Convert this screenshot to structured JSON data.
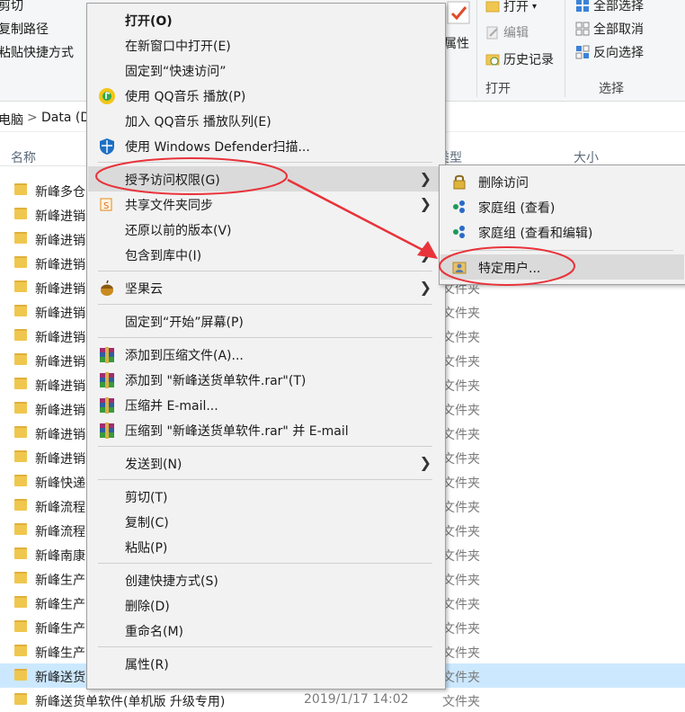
{
  "ribbon": {
    "left_items": [
      "剪切",
      "复制路径",
      "粘贴快捷方式"
    ],
    "properties_label": "属性",
    "open_items": [
      "打开",
      "编辑",
      "历史记录"
    ],
    "open_group": "打开",
    "select_items": [
      "全部选择",
      "全部取消",
      "反向选择"
    ],
    "select_group": "选择"
  },
  "address": {
    "part1": "电脑",
    "sep": ">",
    "part2": "Data (D"
  },
  "columns": {
    "name": "名称",
    "type": "类型",
    "size": "大小"
  },
  "file_rows": [
    {
      "name": "新峰多仓",
      "type": ""
    },
    {
      "name": "新峰进销",
      "type": ""
    },
    {
      "name": "新峰进销",
      "type": ""
    },
    {
      "name": "新峰进销",
      "type": ""
    },
    {
      "name": "新峰进销",
      "type": "文件夹"
    },
    {
      "name": "新峰进销",
      "type": "文件夹"
    },
    {
      "name": "新峰进销",
      "type": "文件夹"
    },
    {
      "name": "新峰进销",
      "type": "文件夹"
    },
    {
      "name": "新峰进销",
      "type": "文件夹"
    },
    {
      "name": "新峰进销",
      "type": "文件夹"
    },
    {
      "name": "新峰进销",
      "type": "文件夹"
    },
    {
      "name": "新峰进销",
      "type": "文件夹"
    },
    {
      "name": "新峰快递",
      "type": "文件夹"
    },
    {
      "name": "新峰流程",
      "type": "文件夹"
    },
    {
      "name": "新峰流程",
      "type": "文件夹"
    },
    {
      "name": "新峰南康",
      "type": "文件夹"
    },
    {
      "name": "新峰生产",
      "type": "文件夹"
    },
    {
      "name": "新峰生产",
      "type": "文件夹"
    },
    {
      "name": "新峰生产",
      "type": "文件夹"
    },
    {
      "name": "新峰生产",
      "type": "文件夹"
    },
    {
      "name": "新峰送货",
      "type": "文件夹"
    },
    {
      "name": "新峰送货单软件(单机版 升级专用)",
      "type": "文件夹"
    }
  ],
  "last_row_date": "2019/1/17 14:02",
  "context_menu": {
    "open": "打开(O)",
    "open_new_window": "在新窗口中打开(E)",
    "pin_quick_access": "固定到“快速访问”",
    "qq_play": "使用 QQ音乐 播放(P)",
    "qq_queue": "加入 QQ音乐 播放队列(E)",
    "defender": "使用 Windows Defender扫描...",
    "grant_access": "授予访问权限(G)",
    "share_sync": "共享文件夹同步",
    "restore": "还原以前的版本(V)",
    "include_library": "包含到库中(I)",
    "jianguoyun": "坚果云",
    "pin_start": "固定到“开始”屏幕(P)",
    "add_archive": "添加到压缩文件(A)...",
    "add_rar": "添加到 \"新峰送货单软件.rar\"(T)",
    "compress_email": "压缩并 E-mail...",
    "compress_rar_email": "压缩到 \"新峰送货单软件.rar\" 并 E-mail",
    "send_to": "发送到(N)",
    "cut": "剪切(T)",
    "copy": "复制(C)",
    "paste": "粘贴(P)",
    "create_shortcut": "创建快捷方式(S)",
    "delete": "删除(D)",
    "rename": "重命名(M)",
    "properties": "属性(R)"
  },
  "submenu": {
    "remove_access": "删除访问",
    "homegroup_view": "家庭组 (查看)",
    "homegroup_edit": "家庭组 (查看和编辑)",
    "specific_users": "特定用户..."
  },
  "colors": {
    "highlight": "#dadada",
    "annotation": "#e8333a",
    "selected_row": "#cce8ff"
  }
}
